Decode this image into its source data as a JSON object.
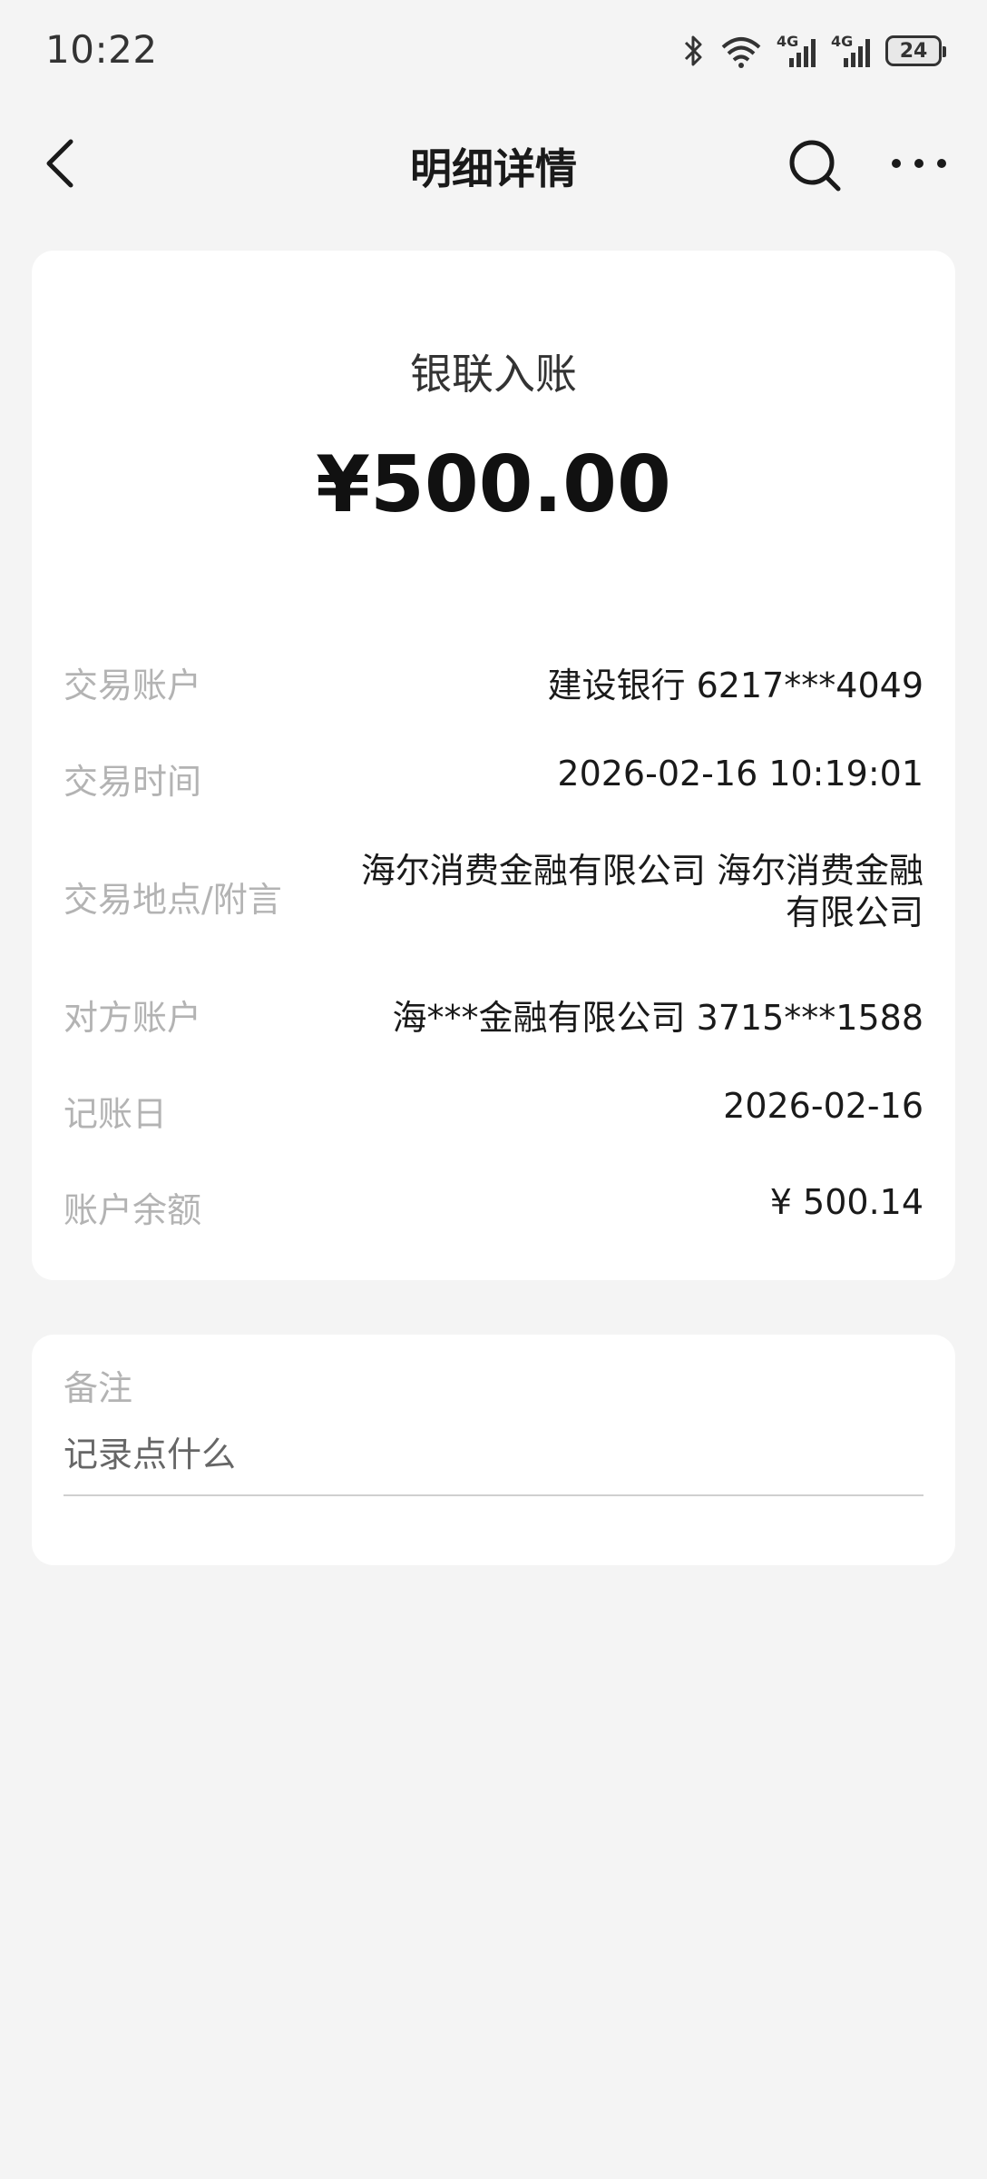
{
  "status_bar": {
    "time": "10:22",
    "network_1": "4G",
    "network_2": "4G",
    "battery": "24"
  },
  "nav": {
    "title": "明细详情"
  },
  "transaction": {
    "type": "银联入账",
    "amount": "¥500.00",
    "rows": [
      {
        "label": "交易账户",
        "value": "建设银行 6217***4049"
      },
      {
        "label": "交易时间",
        "value": "2026-02-16 10:19:01"
      },
      {
        "label": "交易地点/附言",
        "value": "海尔消费金融有限公司 海尔消费金融有限公司"
      },
      {
        "label": "对方账户",
        "value": "海***金融有限公司 3715***1588"
      },
      {
        "label": "记账日",
        "value": "2026-02-16"
      },
      {
        "label": "账户余额",
        "value": "¥ 500.14"
      }
    ]
  },
  "remark": {
    "label": "备注",
    "placeholder": "记录点什么"
  }
}
